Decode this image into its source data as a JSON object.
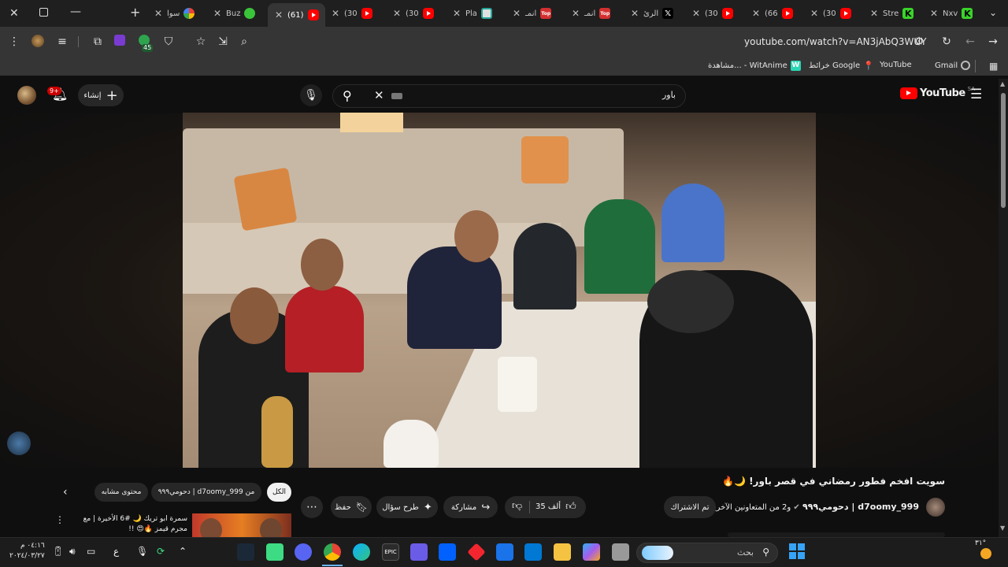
{
  "browser": {
    "tabs": [
      {
        "title": "",
        "icon": "new-tab"
      },
      {
        "title": "سوا",
        "icon": "google"
      },
      {
        "title": "Buz",
        "icon": "green-circle"
      },
      {
        "title": "(61)",
        "icon": "youtube",
        "active": true
      },
      {
        "title": "(30",
        "icon": "youtube"
      },
      {
        "title": "(30",
        "icon": "youtube"
      },
      {
        "title": "Pla",
        "icon": "play-game"
      },
      {
        "title": "انمـ",
        "icon": "top-anime"
      },
      {
        "title": "انمـ",
        "icon": "top-anime"
      },
      {
        "title": "الرئ",
        "icon": "x-twitter"
      },
      {
        "title": "(30",
        "icon": "youtube"
      },
      {
        "title": "(66",
        "icon": "youtube"
      },
      {
        "title": "(30",
        "icon": "youtube"
      },
      {
        "title": "Stre",
        "icon": "kick"
      },
      {
        "title": "Nxv",
        "icon": "kick"
      }
    ],
    "url": "youtube.com/watch?v=AN3jAbQ3WUY",
    "extension_badge": "45",
    "bookmarks": [
      "Gmail",
      "YouTube",
      "خرائط Google",
      "مشاهدة... - WitAnime"
    ]
  },
  "youtube": {
    "logo_text": "YouTube",
    "region": "SA",
    "search_value": "باور",
    "create_label": "إنشاء",
    "notif_count": "9+",
    "video_title": "سويت افخم فطور رمضاني في قصر باور! 🌙🔥",
    "channel_name": "d7oomy_999 | دحومي٩٩٩",
    "collaborators": "و2 من المتعاونين الآخرين",
    "subscribe_label": "تم الاشتراك",
    "likes": "35 ألف",
    "share_label": "مشاركة",
    "ask_label": "طرح سؤال",
    "save_label": "حفظ",
    "chips": [
      "الكل",
      "من d7oomy_999 | دحومي٩٩٩",
      "محتوى مشابه"
    ],
    "rec_title": "سمرة ابو تريك 🌙 #6 الأخيرة | مع مجرم قيمز 🔥😍 !!"
  },
  "taskbar": {
    "search_placeholder": "بحث",
    "time": "٠٤:١٦ م",
    "date": "٢٠٢٤/٠٣/٢٧",
    "temp": "٣١°",
    "lang": "ع"
  }
}
